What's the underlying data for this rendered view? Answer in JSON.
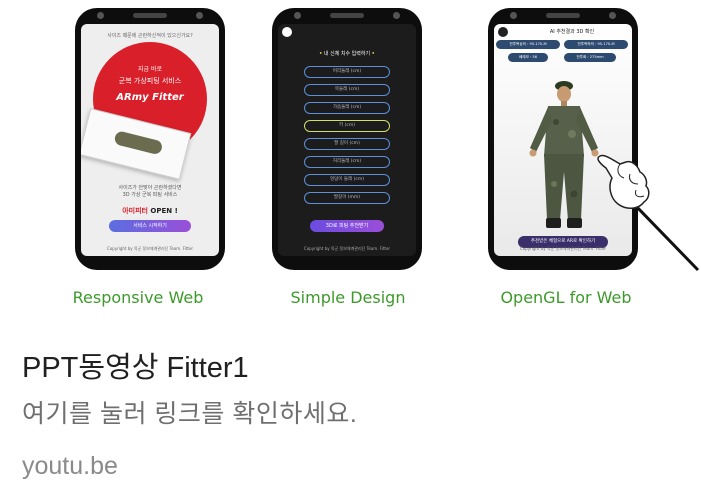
{
  "link_card": {
    "title": "PPT동영상 Fitter1",
    "description": "여기를 눌러 링크를 확인하세요.",
    "domain": "youtu.be"
  },
  "preview": {
    "captions": [
      "Responsive Web",
      "Simple Design",
      "OpenGL for Web"
    ],
    "caption_color": "#3d9a2a",
    "phone1": {
      "question": "사이즈 때문에 곤란하신적이 있으신가요?",
      "line1": "지금 바로",
      "line2": "군복 가상피팅 서비스",
      "brand": "ARmy Fitter",
      "body1": "사이즈가 안맞아 곤란하셨다면",
      "body2": "3D 가상 군복 피팅 서비스",
      "open_prefix": "아미피터",
      "open_suffix": " OPEN !",
      "cta": "서비스 시작하기",
      "footer": "Copyright by 육군 정보체계관리단 Team. Fitter",
      "accent": "#d9202a"
    },
    "phone2": {
      "header_prefix": "•",
      "header": " 내 신체 치수 입력하기 ",
      "header_suffix": "•",
      "fields": [
        "머리둘레 (cm)",
        "목둘레 (cm)",
        "가슴둘레 (cm)",
        "키 (cm)",
        "팔 길이 (cm)",
        "허리둘레 (cm)",
        "엉덩이 둘레 (cm)",
        "발길이 (mm)"
      ],
      "active_field_index": 3,
      "cta": "3D로 피팅 추천받기",
      "footer": "Copyright by 육군 정보체계관리단 Team. Fitter"
    },
    "phone3": {
      "header": "AI 추천결과 3D 확인",
      "pills": [
        "전투복상의 : 95-170-M",
        "전투복하의 : 95-170-M",
        "베레모 : 56",
        "전투화 : 275mm"
      ],
      "cta": "추천받은 체형으로 AR로 확인하기",
      "footer": "Copyright by 육군 정보체계관리단 Team. Fitter"
    }
  }
}
